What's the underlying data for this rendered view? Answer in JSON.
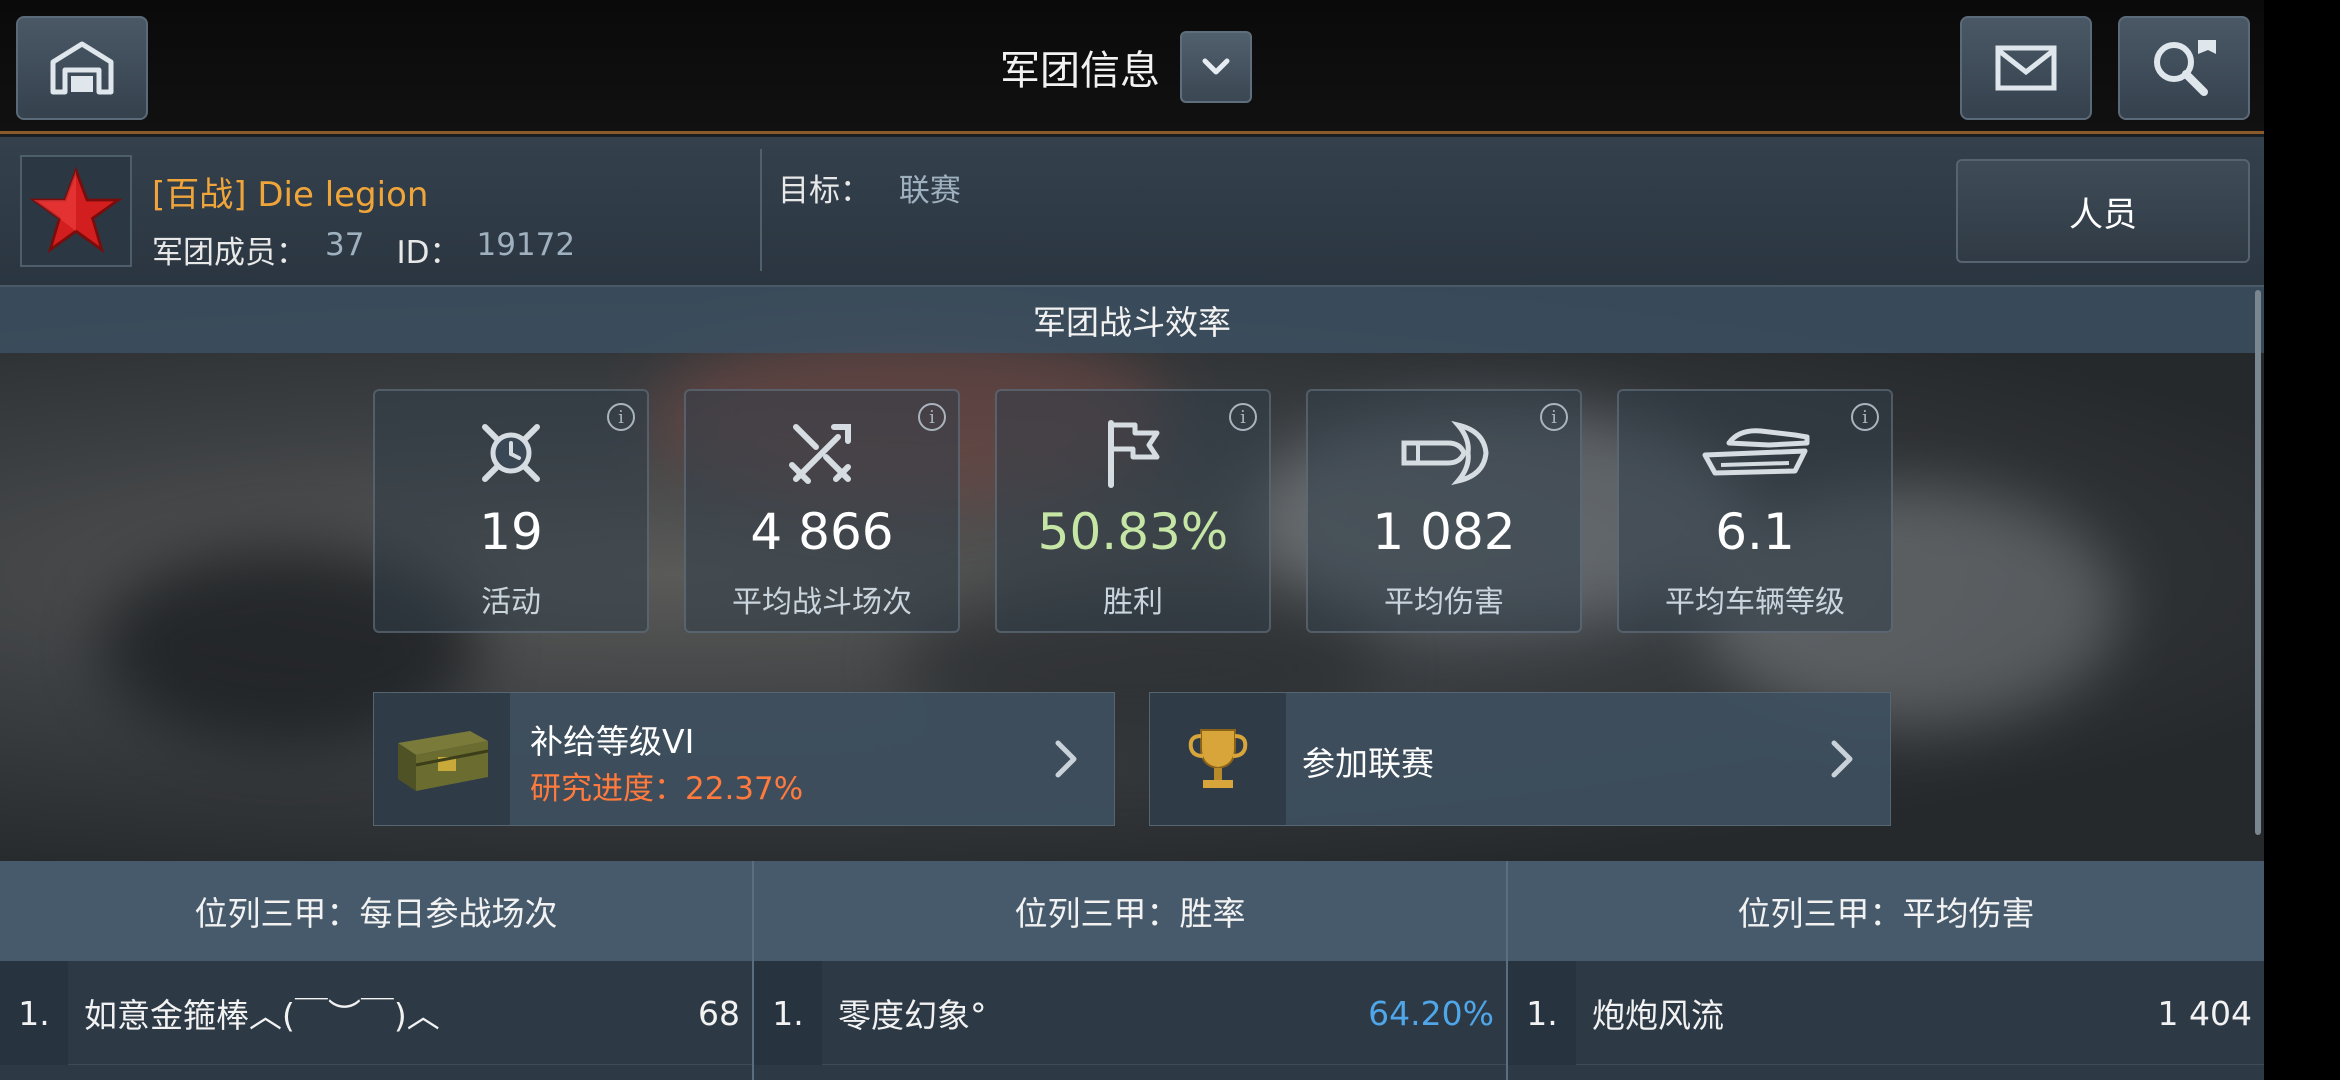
{
  "header": {
    "title": "军团信息"
  },
  "clan": {
    "name": "[百战] Die legion",
    "members_label": "军团成员：",
    "members_count": "37",
    "id_label": "ID：",
    "id_value": "19172",
    "goal_label": "目标：",
    "goal_value": "联赛",
    "members_button": "人员"
  },
  "efficiency": {
    "title": "军团战斗效率",
    "stats": [
      {
        "icon": "clock-badge-icon",
        "value": "19",
        "label": "活动"
      },
      {
        "icon": "crossed-swords-icon",
        "value": "4 866",
        "label": "平均战斗场次"
      },
      {
        "icon": "flag-icon",
        "value": "50.83%",
        "label": "胜利"
      },
      {
        "icon": "shell-damage-icon",
        "value": "1 082",
        "label": "平均伤害"
      },
      {
        "icon": "tank-icon",
        "value": "6.1",
        "label": "平均车辆等级"
      }
    ],
    "info_glyph": "i"
  },
  "supply": {
    "title": "补给等级VI",
    "progress": "研究进度：22.37%",
    "icon": "supply-crate-icon"
  },
  "league": {
    "title": "参加联赛",
    "icon": "trophy-icon"
  },
  "boards": [
    {
      "title": "位列三甲：每日参战场次",
      "rank": "1.",
      "name": "如意金箍棒︿(￣︶￣)︿",
      "value": "68"
    },
    {
      "title": "位列三甲：胜率",
      "rank": "1.",
      "name": "零度幻象°",
      "value": "64.20%"
    },
    {
      "title": "位列三甲：平均伤害",
      "rank": "1.",
      "name": "炮炮风流",
      "value": "1 404"
    }
  ],
  "colors": {
    "accent_orange": "#f0a53a",
    "win_green": "#c6e6a6",
    "winrate_blue": "#4fa6e8",
    "progress_orange": "#ff7a3c"
  }
}
